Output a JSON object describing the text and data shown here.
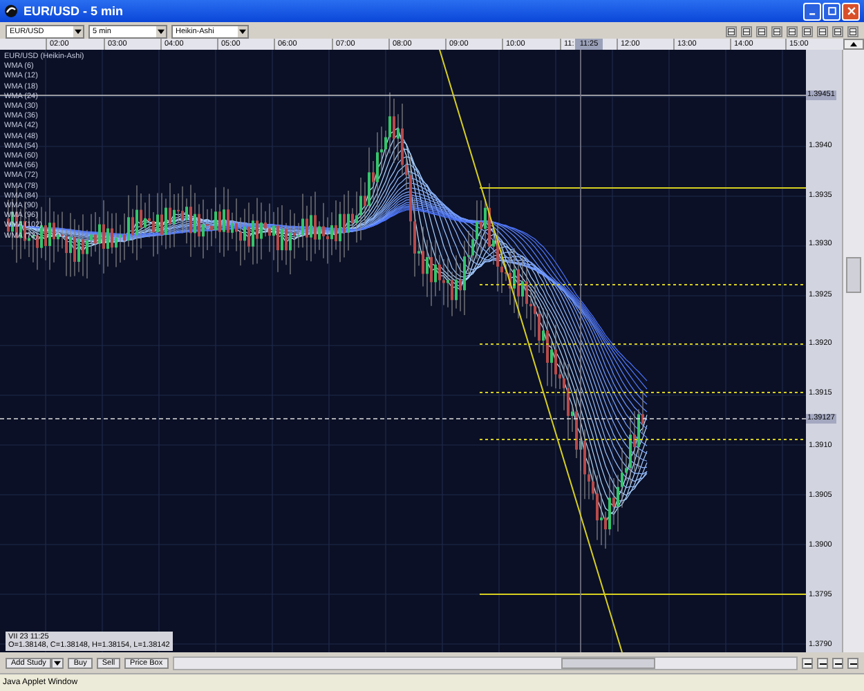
{
  "window": {
    "title": "EUR/USD - 5 min"
  },
  "toolbar": {
    "dropdowns": [
      "EUR/USD",
      "5 min",
      "Heikin-Ashi"
    ]
  },
  "time_axis": {
    "labels": [
      "02:00",
      "03:00",
      "04:00",
      "05:00",
      "06:00",
      "07:00",
      "08:00",
      "09:00",
      "10:00",
      "11:",
      "12:00",
      "13:00",
      "14:00",
      "15:00"
    ],
    "cursor_label": "11:25"
  },
  "chart": {
    "title": "EUR/USD (Heikin-Ashi)",
    "studies": [
      "WMA (6)",
      "WMA (12)",
      "WMA (18)",
      "WMA (24)",
      "WMA (30)",
      "WMA (36)",
      "WMA (42)",
      "WMA (48)",
      "WMA (54)",
      "WMA (60)",
      "WMA (66)",
      "WMA (72)",
      "WMA (78)",
      "WMA (84)",
      "WMA (90)",
      "WMA (96)",
      "WMA (102)",
      "WMA (72)"
    ],
    "info": {
      "date": "VII 23 11:25",
      "ohlc": "O=1.38148, C=1.38148, H=1.38154, L=1.38142"
    }
  },
  "price_axis": {
    "labels": [
      "1.3940",
      "1.3935",
      "1.3930",
      "1.3925",
      "1.3920",
      "1.3915",
      "1.3910",
      "1.3905",
      "1.3900",
      "1.3795",
      "1.3790"
    ],
    "markers": [
      "1.39451",
      "1.39127"
    ]
  },
  "bottom_bar": {
    "study_menu": "Add Study",
    "buttons": [
      "Buy",
      "Sell",
      "Price Box"
    ]
  },
  "status_bar": {
    "text": "Java Applet Window"
  }
}
